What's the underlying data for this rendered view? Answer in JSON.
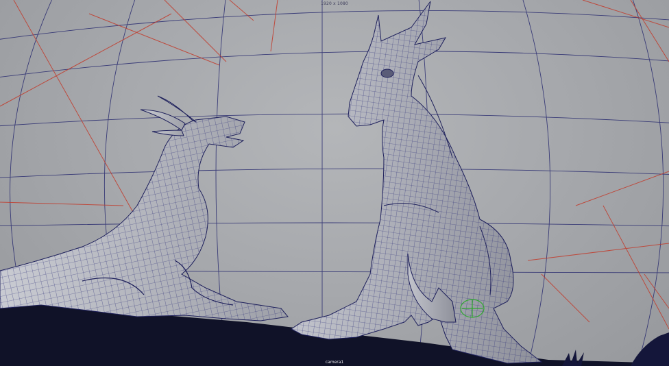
{
  "viewport": {
    "resolution_label": "1920 x 1080",
    "camera_label": "camera1"
  },
  "scene": {
    "objects": [
      "dragon-lying",
      "dragon-sitting",
      "green-locator"
    ]
  },
  "colors": {
    "background": "#a7a9ad",
    "grid_blue": "#26286e",
    "grid_red": "#c23a2a",
    "wireframe": "#2a2c78",
    "mesh_fill": "#b9bbc2",
    "ground": "#101228",
    "locator": "#2fa82f"
  }
}
